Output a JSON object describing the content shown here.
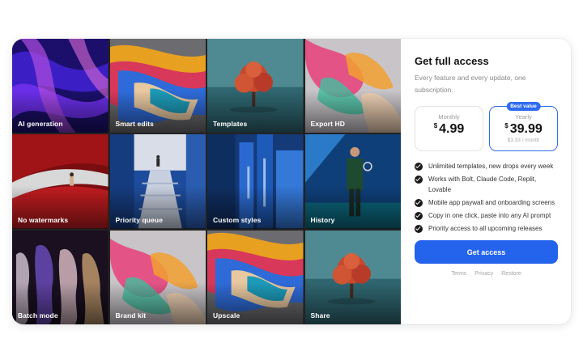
{
  "tiles": [
    {
      "label": "AI generation"
    },
    {
      "label": "Smart edits"
    },
    {
      "label": "Templates"
    },
    {
      "label": "Export HD"
    },
    {
      "label": "No watermarks"
    },
    {
      "label": "Priority queue"
    },
    {
      "label": "Custom styles"
    },
    {
      "label": "History"
    },
    {
      "label": "Batch mode"
    },
    {
      "label": "Brand kit"
    },
    {
      "label": "Upscale"
    },
    {
      "label": "Share"
    }
  ],
  "panel": {
    "title": "Get full access",
    "subtitle": "Every feature and every update, one subscription."
  },
  "plans": {
    "monthly": {
      "name": "Monthly",
      "currency": "$",
      "amount": "4.99"
    },
    "yearly": {
      "name": "Yearly",
      "currency": "$",
      "amount": "39.99",
      "per_month": "$3.33 / month",
      "badge": "Best value"
    }
  },
  "features": [
    "Unlimited templates, new drops every week",
    "Works with Bolt, Claude Code, Replit, Lovable",
    "Mobile app paywall and onboarding screens",
    "Copy in one click, paste into any AI prompt",
    "Priority access to all upcoming releases"
  ],
  "cta": {
    "label": "Get access"
  },
  "footer_links": {
    "terms": "Terms",
    "privacy": "Privacy",
    "restore": "Restore"
  },
  "colors": {
    "accent": "#2463eb",
    "selected_border": "#2f6bf0"
  }
}
